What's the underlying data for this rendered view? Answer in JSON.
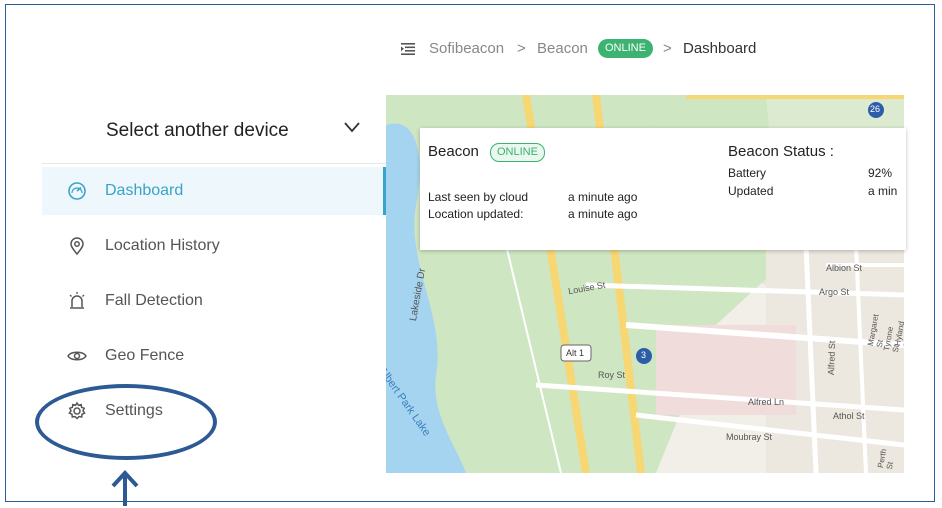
{
  "header": {
    "breadcrumb": [
      "Sofibeacon",
      "Beacon",
      "Dashboard"
    ],
    "separator": ">",
    "status_badge": "ONLINE"
  },
  "sidebar": {
    "device_select_label": "Select another device",
    "items": [
      {
        "label": "Dashboard",
        "icon": "dashboard-gauge-icon",
        "active": true
      },
      {
        "label": "Location History",
        "icon": "location-pin-icon",
        "active": false
      },
      {
        "label": "Fall Detection",
        "icon": "alarm-light-icon",
        "active": false
      },
      {
        "label": "Geo Fence",
        "icon": "eye-icon",
        "active": false
      },
      {
        "label": "Settings",
        "icon": "gear-icon",
        "active": false
      }
    ]
  },
  "card": {
    "device_name": "Beacon",
    "badge": "ONLINE",
    "last_seen_label": "Last seen by cloud",
    "last_seen_value": "a minute ago",
    "location_label": "Location updated:",
    "location_value": "a minute ago",
    "status_title": "Beacon Status :",
    "battery_label": "Battery",
    "battery_value": "92%",
    "updated_label": "Updated",
    "updated_value": "a min"
  },
  "map": {
    "streets": [
      "Lakeside Dr",
      "Albert Park Lake",
      "Louise St",
      "Roy St",
      "Alfred Ln",
      "Alfred St",
      "Athol St",
      "Moubray St",
      "Albion St",
      "Argo St",
      "Margaret St",
      "Tyrone St",
      "Hyland St",
      "Perth St"
    ],
    "shields": [
      "Alt 1",
      "3",
      "26"
    ]
  },
  "colors": {
    "accent": "#3aa3c9",
    "online": "#3cb371",
    "annotation": "#2d5a94",
    "water": "#a5d4f0",
    "park": "#c9e3bd",
    "road_major": "#f7d774"
  }
}
